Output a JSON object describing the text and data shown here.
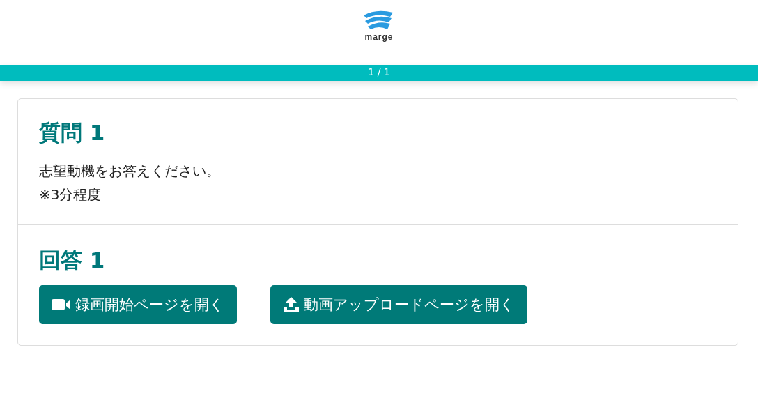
{
  "header": {
    "logo_text": "marge"
  },
  "progress": {
    "label": "1 / 1",
    "level": 1
  },
  "question": {
    "title": "質問 1",
    "lines": [
      "志望動機をお答えください。",
      "※3分程度"
    ]
  },
  "answer": {
    "title": "回答 1",
    "buttons": [
      {
        "kind": "record",
        "label": "録画開始ページを開く"
      },
      {
        "kind": "upload",
        "label": "動画アップロードページを開く"
      }
    ]
  }
}
